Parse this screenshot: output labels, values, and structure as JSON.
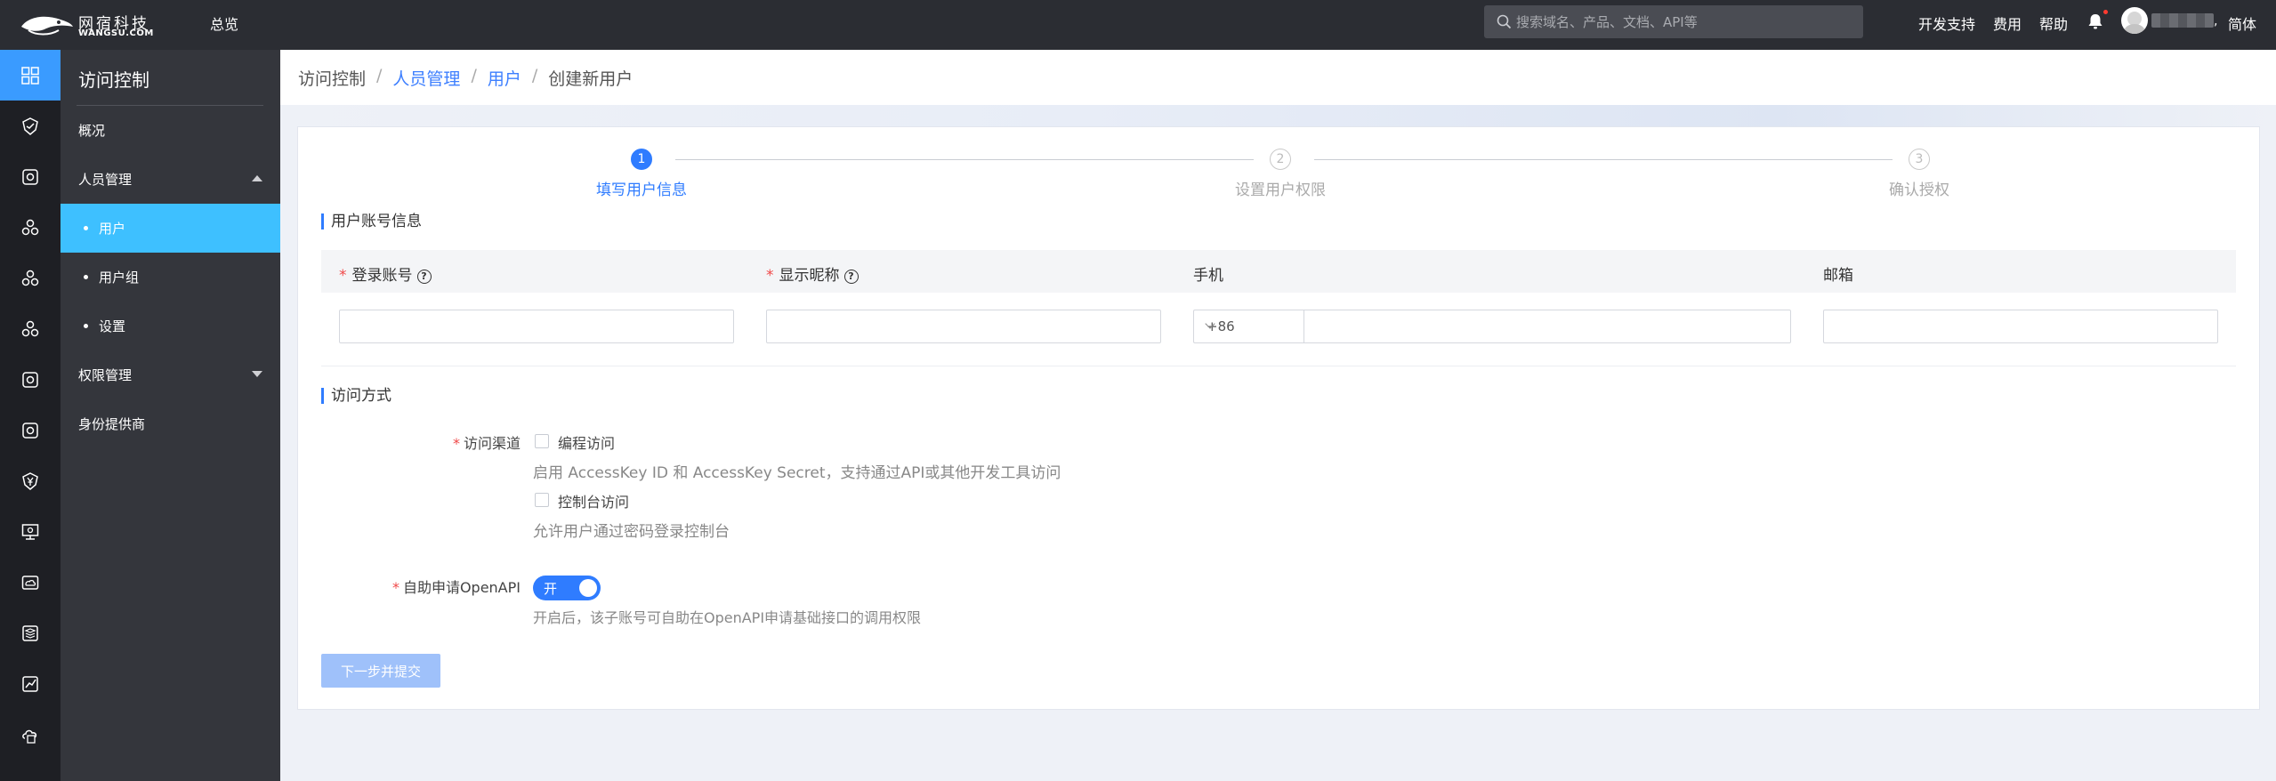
{
  "topbar": {
    "logo_cn": "网宿科技",
    "logo_en": "WANGSU.COM",
    "overview": "总览",
    "search_placeholder": "搜索域名、产品、文档、API等",
    "dev_support": "开发支持",
    "fees": "费用",
    "help": "帮助",
    "language": "简体"
  },
  "rail": {
    "icons": [
      "grid-icon",
      "shield-icon",
      "shield-badge-icon",
      "cluster-icon",
      "cluster-icon",
      "cluster-icon",
      "shield-badge-icon",
      "shield-badge-icon",
      "yen-icon",
      "monitor-icon",
      "cloud-monitor-icon",
      "stack-icon",
      "chart-icon",
      "cloud-doc-icon"
    ],
    "accent": "#3a9bff"
  },
  "sidebar": {
    "title": "访问控制",
    "overview": "概况",
    "people_mgmt": "人员管理",
    "sub": [
      "用户",
      "用户组",
      "设置"
    ],
    "perm_mgmt": "权限管理",
    "idp": "身份提供商",
    "active_color": "#3ec0ff"
  },
  "breadcrumb": {
    "root": "访问控制",
    "people": "人员管理",
    "users": "用户",
    "current": "创建新用户"
  },
  "steps": [
    {
      "num": "1",
      "label": "填写用户信息"
    },
    {
      "num": "2",
      "label": "设置用户权限"
    },
    {
      "num": "3",
      "label": "确认授权"
    }
  ],
  "form": {
    "section_account": "用户账号信息",
    "col_login": "登录账号",
    "col_nick": "显示昵称",
    "col_phone": "手机",
    "col_email": "邮箱",
    "country_code": "+86",
    "section_access": "访问方式",
    "channel_label": "访问渠道",
    "opt_program": "编程访问",
    "opt_program_hint": "启用 AccessKey ID 和 AccessKey Secret，支持通过API或其他开发工具访问",
    "opt_console": "控制台访问",
    "opt_console_hint": "允许用户通过密码登录控制台",
    "openapi_label": "自助申请OpenAPI",
    "toggle_on": "开",
    "openapi_hint": "开启后，该子账号可自助在OpenAPI申请基础接口的调用权限",
    "submit": "下一步并提交",
    "primary_color": "#2f7cff"
  }
}
